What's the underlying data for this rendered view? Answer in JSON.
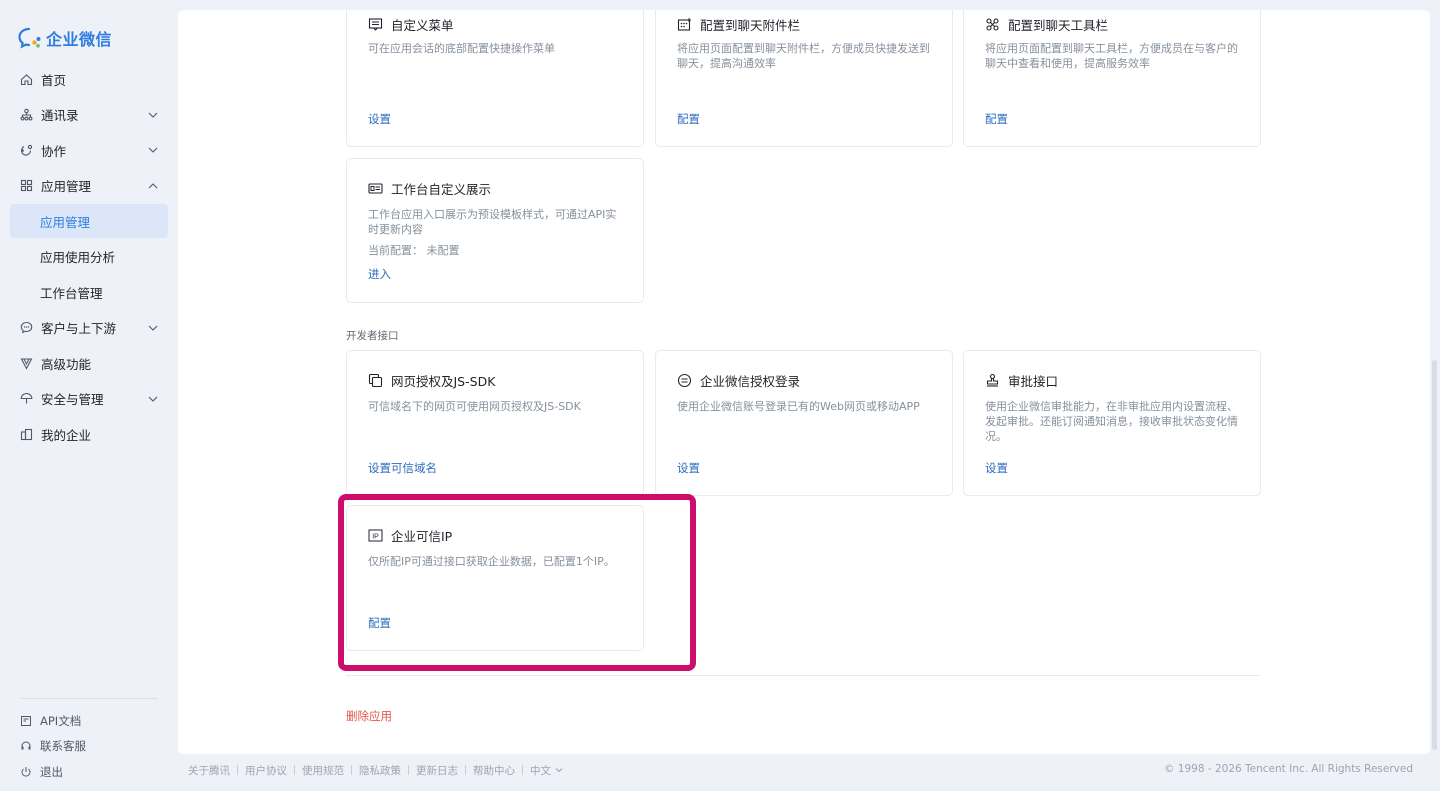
{
  "brand": {
    "name": "企业微信",
    "color": "#2f7de1"
  },
  "nav": {
    "items": [
      {
        "label": "首页",
        "icon": "home-icon"
      },
      {
        "label": "通讯录",
        "icon": "org-chart-icon",
        "expandable": true
      },
      {
        "label": "协作",
        "icon": "collaboration-icon",
        "expandable": true
      },
      {
        "label": "应用管理",
        "icon": "apps-grid-icon",
        "expanded": true
      },
      {
        "label": "应用管理",
        "sub": true,
        "active": true
      },
      {
        "label": "应用使用分析",
        "sub": true
      },
      {
        "label": "工作台管理",
        "sub": true
      },
      {
        "label": "客户与上下游",
        "icon": "chat-bubble-icon",
        "expandable": true
      },
      {
        "label": "高级功能",
        "icon": "triangle-filter-icon"
      },
      {
        "label": "安全与管理",
        "icon": "umbrella-icon",
        "expandable": true
      },
      {
        "label": "我的企业",
        "icon": "building-icon"
      }
    ]
  },
  "bottom_links": [
    {
      "label": "API文档",
      "icon": "document-icon"
    },
    {
      "label": "联系客服",
      "icon": "headset-icon"
    },
    {
      "label": "退出",
      "icon": "power-icon"
    }
  ],
  "cards_top": [
    {
      "title": "自定义菜单",
      "icon": "menu-card-icon",
      "desc": "可在应用会话的底部配置快捷操作菜单",
      "link": "设置"
    },
    {
      "title": "配置到聊天附件栏",
      "icon": "attachment-grid-icon",
      "desc": "将应用页面配置到聊天附件栏，方便成员快捷发送到聊天，提高沟通效率",
      "link": "配置"
    },
    {
      "title": "配置到聊天工具栏",
      "icon": "toolbar-icon",
      "desc": "将应用页面配置到聊天工具栏，方便成员在与客户的聊天中查看和使用，提高服务效率",
      "link": "配置"
    },
    {
      "title": "工作台自定义展示",
      "icon": "workbench-card-icon",
      "desc": "工作台应用入口展示为预设模板样式，可通过API实时更新内容",
      "extra": "当前配置： 未配置",
      "link": "进入"
    }
  ],
  "section_developer": "开发者接口",
  "cards_dev": [
    {
      "title": "网页授权及JS-SDK",
      "icon": "copy-windows-icon",
      "desc": "可信域名下的网页可使用网页授权及JS-SDK",
      "link": "设置可信域名"
    },
    {
      "title": "企业微信授权登录",
      "icon": "login-circle-icon",
      "desc": "使用企业微信账号登录已有的Web网页或移动APP",
      "link": "设置"
    },
    {
      "title": "审批接口",
      "icon": "stamp-icon",
      "desc": "使用企业微信审批能力，在非审批应用内设置流程、发起审批。还能订阅通知消息，接收审批状态变化情况。",
      "link": "设置"
    },
    {
      "title": "企业可信IP",
      "icon": "ip-badge-icon",
      "desc": "仅所配IP可通过接口获取企业数据，已配置1个IP。",
      "link": "配置"
    }
  ],
  "delete_app": "删除应用",
  "highlight_color": "#cc0d6b",
  "footer": {
    "links": [
      "关于腾讯",
      "用户协议",
      "使用规范",
      "隐私政策",
      "更新日志",
      "帮助中心"
    ],
    "language": "中文",
    "copyright": "© 1998 - 2026 Tencent Inc. All Rights Reserved"
  }
}
